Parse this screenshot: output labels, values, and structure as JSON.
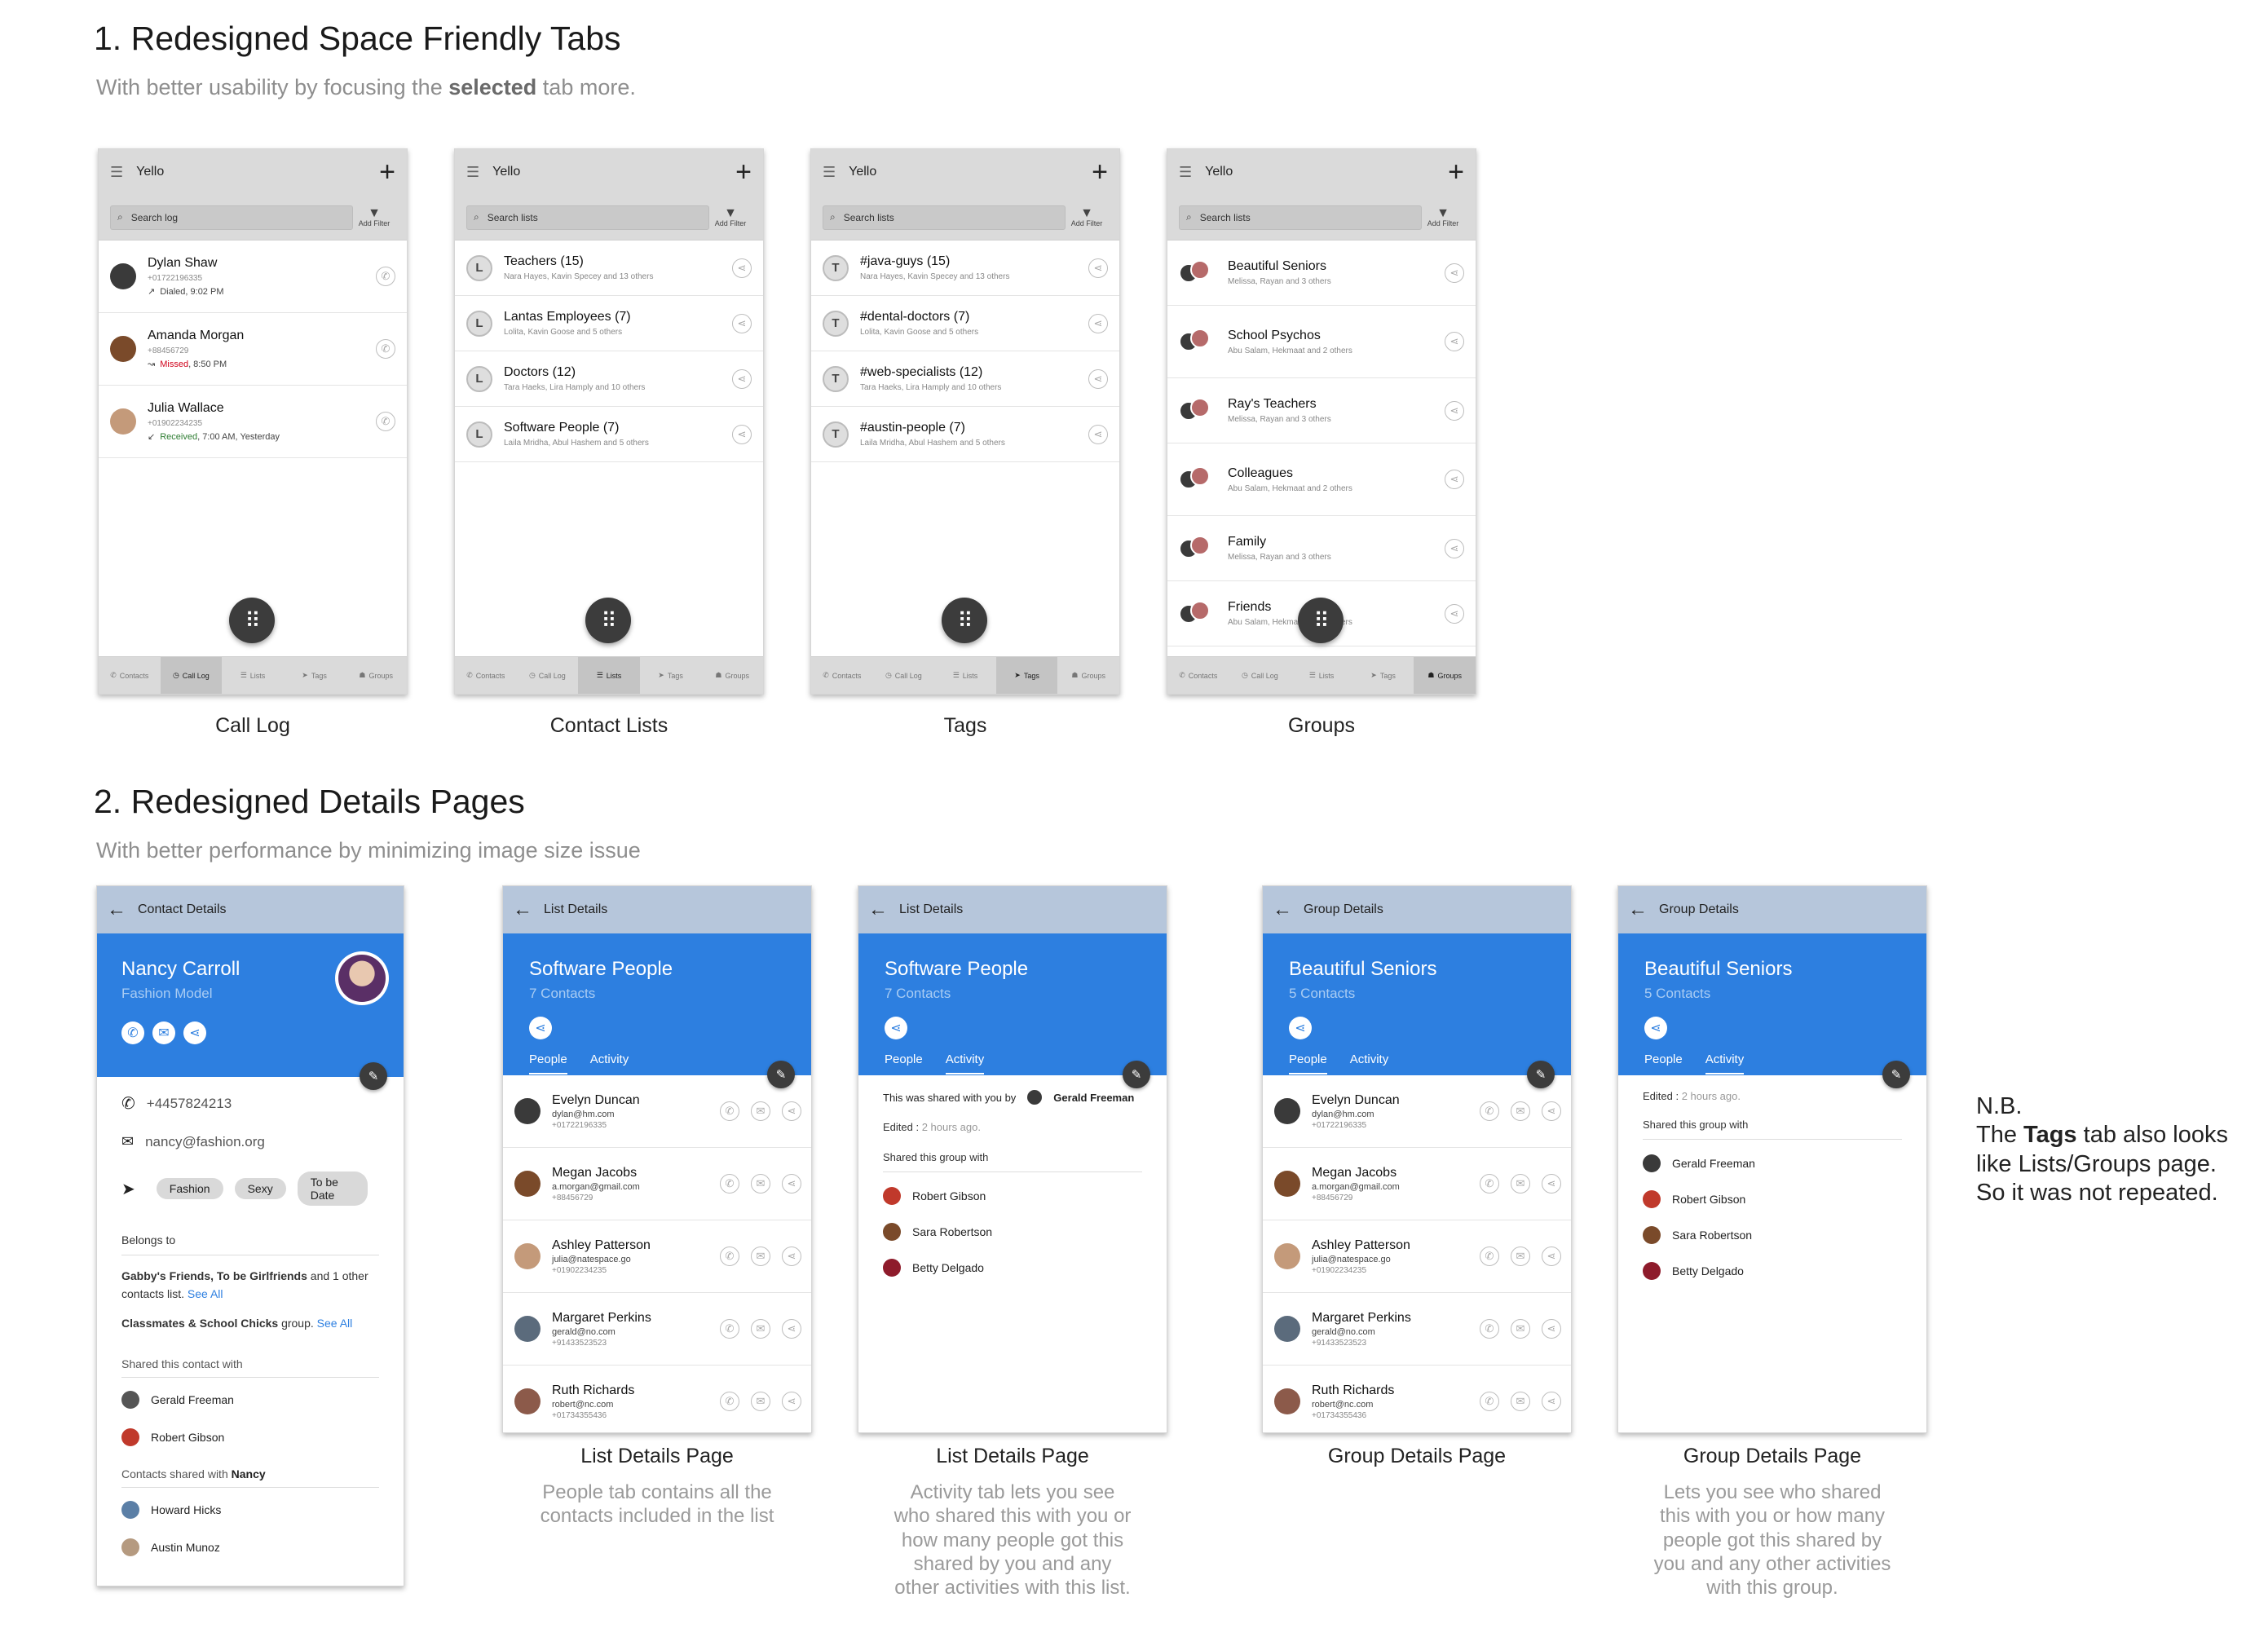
{
  "section1": {
    "heading": "1. Redesigned Space Friendly Tabs",
    "sub_pre": "With better usability by focusing the ",
    "sub_bold": "selected",
    "sub_post": " tab more."
  },
  "section2": {
    "heading": "2. Redesigned Details Pages",
    "subtitle": "With better performance by minimizing image size issue"
  },
  "app": {
    "title": "Yello",
    "add": "+",
    "add_filter": "Add Filter"
  },
  "nav": [
    "Contacts",
    "Call Log",
    "Lists",
    "Tags",
    "Groups"
  ],
  "calllog": {
    "search": "Search log",
    "caption": "Call Log",
    "items": [
      {
        "name": "Dylan Shaw",
        "number": "+01722196335",
        "status": "Dialed, 9:02 PM",
        "arrow": "↗",
        "color": "#444444"
      },
      {
        "name": "Amanda Morgan",
        "number": "+88456729",
        "status_color": "Missed",
        "status": ", 8:50 PM",
        "arrow": "↝",
        "color": "#d0021b"
      },
      {
        "name": "Julia Wallace",
        "number": "+01902234235",
        "status_color": "Received",
        "status": ", 7:00 AM, Yesterday",
        "arrow": "↙",
        "color": "#2e7d32"
      }
    ]
  },
  "lists": {
    "search": "Search lists",
    "caption": "Contact Lists",
    "items": [
      {
        "letter": "L",
        "name": "Teachers (15)",
        "members": "Nara Hayes, Kavin Specey and 13 others"
      },
      {
        "letter": "L",
        "name": "Lantas Employees (7)",
        "members": "Lolita, Kavin Goose and 5 others"
      },
      {
        "letter": "L",
        "name": "Doctors (12)",
        "members": "Tara Haeks, Lira Hamply and 10 others"
      },
      {
        "letter": "L",
        "name": "Software People (7)",
        "members": "Laila Mridha, Abul Hashem and 5 others"
      }
    ]
  },
  "tags": {
    "search": "Search lists",
    "caption": "Tags",
    "items": [
      {
        "letter": "T",
        "name": "#java-guys (15)",
        "members": "Nara Hayes, Kavin Specey and 13 others"
      },
      {
        "letter": "T",
        "name": "#dental-doctors (7)",
        "members": "Lolita, Kavin Goose and 5 others"
      },
      {
        "letter": "T",
        "name": "#web-specialists (12)",
        "members": "Tara Haeks, Lira Hamply and 10 others"
      },
      {
        "letter": "T",
        "name": "#austin-people (7)",
        "members": "Laila Mridha, Abul Hashem and 5 others"
      }
    ]
  },
  "groups": {
    "search": "Search lists",
    "caption": "Groups",
    "items": [
      {
        "name": "Beautiful Seniors",
        "members": "Melissa, Rayan and 3 others"
      },
      {
        "name": "School Psychos",
        "members": "Abu Salam, Hekmaat and 2 others"
      },
      {
        "name": "Ray's Teachers",
        "members": "Melissa, Rayan and 3 others"
      },
      {
        "name": "Colleagues",
        "members": "Abu Salam, Hekmaat and 2 others"
      },
      {
        "name": "Family",
        "members": "Melissa, Rayan and 3 others"
      },
      {
        "name": "Friends",
        "members": "Abu Salam, Hekmaat and 2 others"
      }
    ]
  },
  "contact": {
    "bar": "Contact Details",
    "name": "Nancy Carroll",
    "job": "Fashion Model",
    "phone": "+4457824213",
    "email": "nancy@fashion.org",
    "chips": [
      "Fashion",
      "Sexy",
      "To be Date"
    ],
    "belongs": "Belongs to",
    "b1": "Gabby's Friends, To be Girlfriends",
    "b2": " and 1 other contacts list.",
    "seeall": "See All",
    "b3": "Classmates & School Chicks",
    "b4": " group.",
    "shared_with": "Shared this contact with",
    "sw": [
      "Gerald Freeman",
      "Robert Gibson"
    ],
    "shared_pre": "Contacts shared with ",
    "shared_name": "Nancy",
    "sn": [
      "Howard Hicks",
      "Austin Munoz"
    ]
  },
  "listdetails": {
    "bar": "List Details",
    "title": "Software People",
    "count": "7 Contacts",
    "caption": "List Details Page"
  },
  "groupdetails": {
    "bar": "Group Details",
    "title": "Beautiful Seniors",
    "count": "5 Contacts",
    "caption": "Group Details Page"
  },
  "tabs": {
    "people": "People",
    "activity": "Activity"
  },
  "people": [
    {
      "name": "Evelyn Duncan",
      "email": "dylan@hm.com",
      "phone": "+01722196335"
    },
    {
      "name": "Megan Jacobs",
      "email": "a.morgan@gmail.com",
      "phone": "+88456729"
    },
    {
      "name": "Ashley Patterson",
      "email": "julia@natespace.go",
      "phone": "+01902234235"
    },
    {
      "name": "Margaret Perkins",
      "email": "gerald@no.com",
      "phone": "+91433523523"
    },
    {
      "name": "Ruth Richards",
      "email": "robert@nc.com",
      "phone": "+01734355436"
    }
  ],
  "activity": {
    "shared_pre": "This was shared with you by",
    "shared_by": "Gerald Freeman",
    "edited_label": "Edited : ",
    "edited": "2 hours ago.",
    "shared_group": "Shared this group with",
    "list_people": [
      "Robert Gibson",
      "Sara Robertson",
      "Betty Delgado"
    ],
    "group_people": [
      "Gerald Freeman",
      "Robert Gibson",
      "Sara Robertson",
      "Betty Delgado"
    ]
  },
  "desc": {
    "list_people": "People tab contains all the contacts included in the list",
    "list_activity": "Activity tab lets you see who shared this with you or how many people got this shared by you and any other activities with this list.",
    "group_activity": "Lets you see who shared this with you or how many people got this shared by you and any other activities with this group."
  },
  "nb": {
    "title": "N.B.",
    "l1_pre": "The ",
    "l1_bold": "Tags",
    "l1_post": " tab also looks",
    "l2": "like Lists/Groups page.",
    "l3": "So it was not repeated."
  },
  "colors": {
    "accent": "#2d7fe0",
    "header_bar": "#b6c6db",
    "missed": "#d0021b",
    "received": "#2e7d32",
    "link": "#2d7fe0"
  }
}
